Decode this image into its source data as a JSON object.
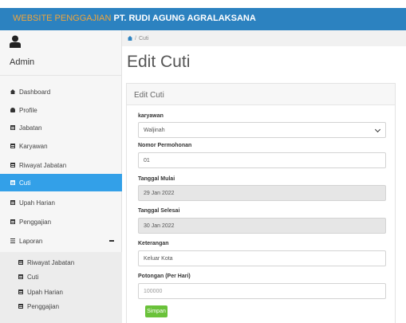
{
  "header": {
    "title_part1": "WEBSITE PENGGAJIAN",
    "title_part2": "PT. RUDI AGUNG AGRALAKSANA"
  },
  "sidebar": {
    "user_name": "Admin",
    "items": [
      {
        "label": "Dashboard",
        "icon": "home-icon"
      },
      {
        "label": "Profile",
        "icon": "user-icon"
      },
      {
        "label": "Jabatan",
        "icon": "table-icon"
      },
      {
        "label": "Karyawan",
        "icon": "table-icon"
      },
      {
        "label": "Riwayat Jabatan",
        "icon": "table-icon"
      },
      {
        "label": "Cuti",
        "icon": "table-icon",
        "active": true
      },
      {
        "label": "Upah Harian",
        "icon": "table-icon"
      },
      {
        "label": "Penggajian",
        "icon": "table-icon"
      },
      {
        "label": "Laporan",
        "icon": "list-icon",
        "expanded": true
      }
    ],
    "submenu": [
      {
        "label": "Riwayat Jabatan"
      },
      {
        "label": "Cuti"
      },
      {
        "label": "Upah Harian"
      },
      {
        "label": "Penggajian"
      }
    ]
  },
  "breadcrumb": {
    "current": "Cuti"
  },
  "page": {
    "title": "Edit Cuti"
  },
  "form": {
    "panel_title": "Edit Cuti",
    "karyawan": {
      "label": "karyawan",
      "value": "Waljinah"
    },
    "nomor": {
      "label": "Nomor Permohonan",
      "value": "01"
    },
    "tanggal_mulai": {
      "label": "Tanggal Mulai",
      "value": "29 Jan 2022"
    },
    "tanggal_selesai": {
      "label": "Tanggal Selesai",
      "value": "30 Jan 2022"
    },
    "keterangan": {
      "label": "Keterangan",
      "value": "Keluar Kota"
    },
    "potongan": {
      "label": "Potongan (Per Hari)",
      "placeholder": "100000"
    },
    "save_label": "Simpan"
  },
  "colors": {
    "header": "#2c82c0",
    "accent_orange": "#f0a53c",
    "active_menu": "#33a0e8",
    "save_button": "#6ac23a"
  }
}
